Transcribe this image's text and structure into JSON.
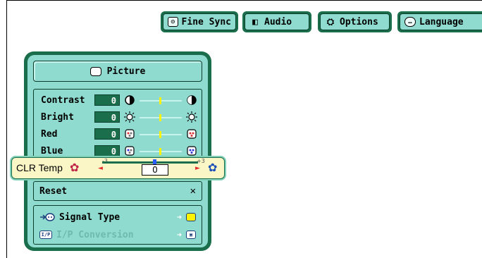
{
  "tabs": [
    {
      "label": "Fine Sync",
      "icon": "fine-sync-icon"
    },
    {
      "label": "Audio",
      "icon": "speaker-icon"
    },
    {
      "label": "Options",
      "icon": "options-icon"
    },
    {
      "label": "Language",
      "icon": "speech-bubble-icon"
    }
  ],
  "panel": {
    "title": "Picture",
    "adjustments": [
      {
        "label": "Contrast",
        "value": "0",
        "icon": "contrast-icon"
      },
      {
        "label": "Bright",
        "value": "0",
        "icon": "brightness-icon"
      },
      {
        "label": "Red",
        "value": "0",
        "icon": "red-icon"
      },
      {
        "label": "Blue",
        "value": "0",
        "icon": "blue-icon"
      }
    ],
    "reset_label": "Reset",
    "reset_symbol": "✕",
    "signal_type_label": "Signal Type",
    "ip_conversion_label": "I/P Conversion",
    "ip_icon_text": "I/P"
  },
  "clr_temp": {
    "label": "CLR Temp",
    "min": "-3",
    "max": "+3",
    "value": "0"
  },
  "colors": {
    "panel_border": "#1a6e4c",
    "panel_fill": "#8fdbd0",
    "popup_fill": "#fbf6c6"
  }
}
